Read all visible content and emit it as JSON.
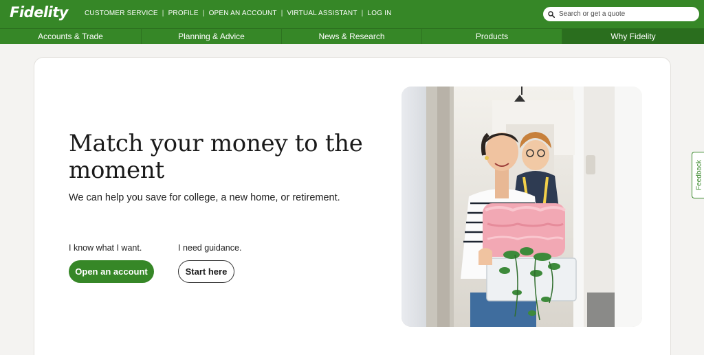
{
  "brand": {
    "logo_text": "Fidelity",
    "accent": "#368727",
    "nav_active": "#2a6e1e"
  },
  "utility_nav": {
    "items": [
      "CUSTOMER SERVICE",
      "PROFILE",
      "OPEN AN ACCOUNT",
      "VIRTUAL ASSISTANT",
      "LOG IN"
    ],
    "separator": "|"
  },
  "search": {
    "placeholder": "Search or get a quote",
    "icon": "search-icon"
  },
  "main_nav": {
    "tabs": [
      {
        "label": "Accounts & Trade"
      },
      {
        "label": "Planning & Advice"
      },
      {
        "label": "News & Research"
      },
      {
        "label": "Products"
      },
      {
        "label": "Why Fidelity",
        "active": true
      }
    ]
  },
  "hero": {
    "headline": "Match your money to the moment",
    "subhead": "We can help you save for college, a new home, or retirement.",
    "cta_left": {
      "label": "I know what I want.",
      "button": "Open an account"
    },
    "cta_right": {
      "label": "I need guidance.",
      "button": "Start here"
    }
  },
  "feedback": {
    "label": "Feedback"
  }
}
